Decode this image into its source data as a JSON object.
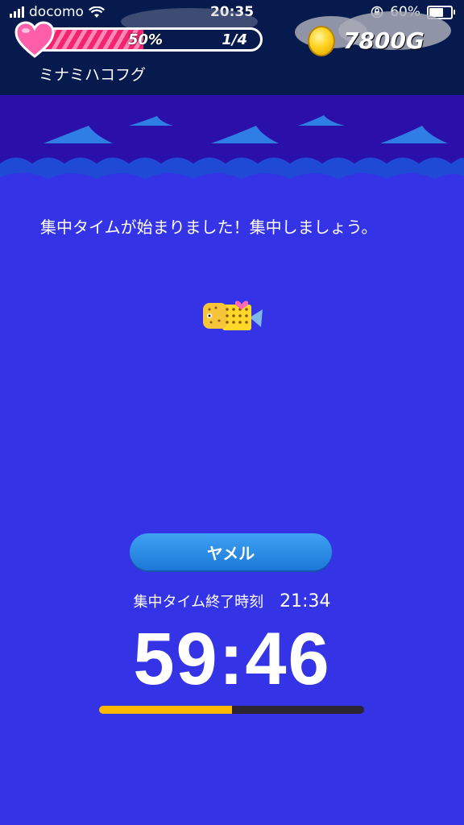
{
  "status_bar": {
    "carrier": "docomo",
    "time": "20:35",
    "battery_text": "60%",
    "battery_level": 0.6
  },
  "header": {
    "affection_percent_text": "50%",
    "affection_level": 0.5,
    "fish_progress": "1/4",
    "gold": "7800G",
    "fish_name": "ミナミハコフグ"
  },
  "main": {
    "message": "集中タイムが始まりました！集中しましょう。",
    "quit_label": "ヤメル",
    "end_time_label": "集中タイム終了時刻",
    "end_time_value": "21:34",
    "timer": "59:46",
    "timer_progress": 0.5
  },
  "colors": {
    "sea": "#3434e6",
    "header": "#061a4e",
    "gauge_pink": "#f4226f",
    "progress_yellow": "#ffb800",
    "button_blue": "#2a8ce6"
  },
  "icons": [
    "signal-icon",
    "wifi-icon",
    "orientation-lock-icon",
    "battery-icon",
    "heart-icon",
    "gold-coin-icon",
    "fish-icon"
  ]
}
